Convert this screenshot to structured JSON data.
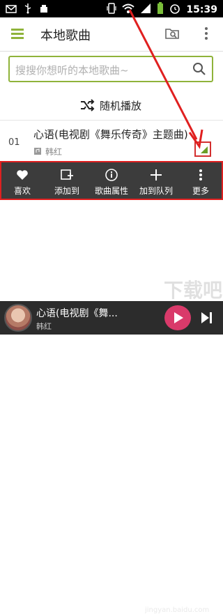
{
  "status_bar": {
    "time": "15:39"
  },
  "app_bar": {
    "title": "本地歌曲"
  },
  "search": {
    "placeholder": "搜搜你想听的本地歌曲~"
  },
  "shuffle": {
    "label": "随机播放"
  },
  "song": {
    "number": "01",
    "title": "心语(电视剧《舞乐传奇》主题曲)",
    "artist": "韩红"
  },
  "actions": [
    {
      "label": "喜欢",
      "icon": "heart-icon"
    },
    {
      "label": "添加到",
      "icon": "add-to-icon"
    },
    {
      "label": "歌曲属性",
      "icon": "info-icon"
    },
    {
      "label": "加到队列",
      "icon": "plus-icon"
    },
    {
      "label": "更多",
      "icon": "more-icon"
    }
  ],
  "player": {
    "title": "心语(电视剧《舞...",
    "artist": "韩红"
  },
  "watermark": {
    "text": "jingyan.baidu.com",
    "big": "下载吧"
  },
  "colors": {
    "accent": "#8fb33a",
    "highlight": "#e02020",
    "action_bar": "#3c3c3c",
    "player_bg": "#2c2c2c"
  }
}
